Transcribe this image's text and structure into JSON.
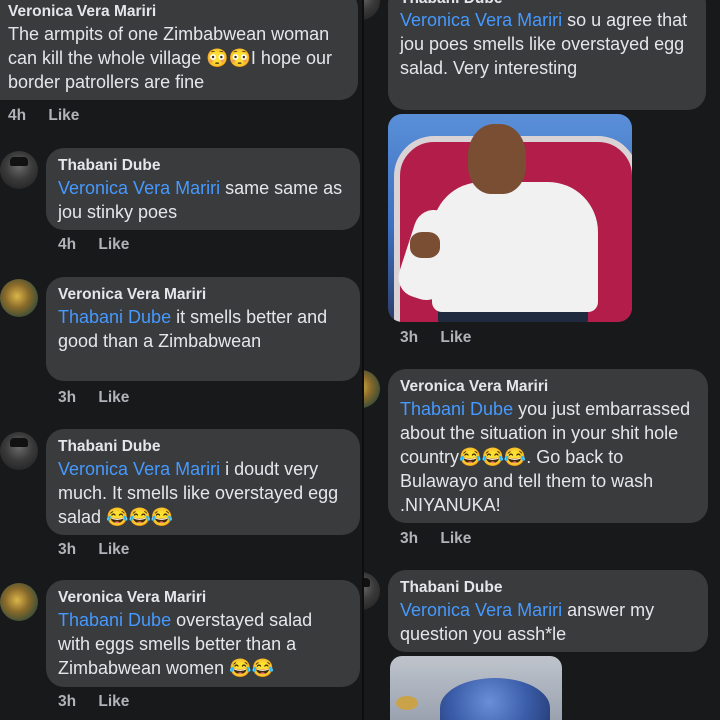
{
  "left": {
    "top_comment": {
      "author": "Veronica Vera Mariri",
      "text": "The armpits of one Zimbabwean woman can kill the whole village 😳😳I hope our border patrollers are fine",
      "time": "4h",
      "like": "Like"
    },
    "comments": [
      {
        "author": "Thabani Dube",
        "mention": "Veronica Vera Mariri",
        "text": " same  same as jou stinky poes",
        "time": "4h",
        "like": "Like"
      },
      {
        "author": "Veronica Vera Mariri",
        "mention": "Thabani Dube",
        "text": " it smells better and good than a Zimbabwean",
        "time": "3h",
        "like": "Like"
      },
      {
        "author": "Thabani Dube",
        "mention": "Veronica Vera Mariri",
        "text": " i doudt very much. It smells like overstayed egg salad 😂😂😂",
        "time": "3h",
        "like": "Like"
      },
      {
        "author": "Veronica Vera Mariri",
        "mention": "Thabani Dube",
        "text": " overstayed salad with eggs  smells better than a Zimbabwean women 😂😂",
        "time": "3h",
        "like": "Like"
      }
    ]
  },
  "right": {
    "top_comment": {
      "author": "Thabani Dube",
      "mention": "Veronica Vera Mariri",
      "text": " so u agree that jou poes smells like overstayed egg salad. Very interesting",
      "time": "3h",
      "like": "Like"
    },
    "comments": [
      {
        "author": "Veronica Vera Mariri",
        "mention": "Thabani Dube",
        "text": " you just embarrassed about the situation in your shit hole country😂😂😂. Go back to Bulawayo and tell them to wash .NIYANUKA!",
        "time": "3h",
        "like": "Like"
      },
      {
        "author": "Thabani Dube",
        "mention": "Veronica Vera Mariri",
        "text": " answer my question you assh*le"
      }
    ]
  },
  "colors": {
    "background": "#18191a",
    "bubble": "#3a3b3c",
    "mention": "#4599ff",
    "meta": "#b0b3b8"
  }
}
